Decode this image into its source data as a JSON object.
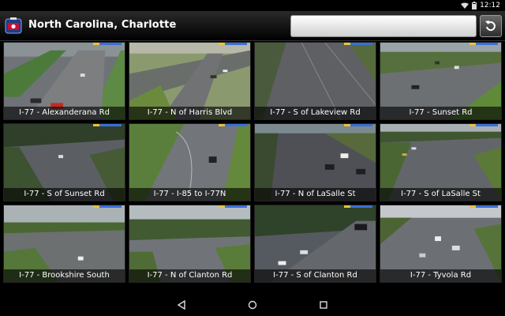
{
  "status": {
    "time": "12:12"
  },
  "header": {
    "title": "North Carolina, Charlotte",
    "app_icon": "traffic-camera-app-icon",
    "search_placeholder": "",
    "refresh_icon": "refresh-icon"
  },
  "cameras": [
    {
      "label": "I-77 - Alexanderana Rd"
    },
    {
      "label": "I-77 - N of Harris Blvd"
    },
    {
      "label": "I-77 - S of Lakeview Rd"
    },
    {
      "label": "I-77 - Sunset Rd"
    },
    {
      "label": "I-77 - S of Sunset Rd"
    },
    {
      "label": "I-77 - I-85 to I-77N"
    },
    {
      "label": "I-77 - N of LaSalle St"
    },
    {
      "label": "I-77 - S of LaSalle St"
    },
    {
      "label": "I-77 - Brookshire South"
    },
    {
      "label": "I-77 - N of Clanton Rd"
    },
    {
      "label": "I-77 - S of Clanton Rd"
    },
    {
      "label": "I-77 - Tyvola Rd"
    }
  ],
  "navbar": {
    "back_icon": "back-icon",
    "home_icon": "home-icon",
    "recents_icon": "recents-icon"
  },
  "colors": {
    "accent": "#3a70d8",
    "ribbon_yellow": "#e9c23a",
    "background": "#000000"
  }
}
